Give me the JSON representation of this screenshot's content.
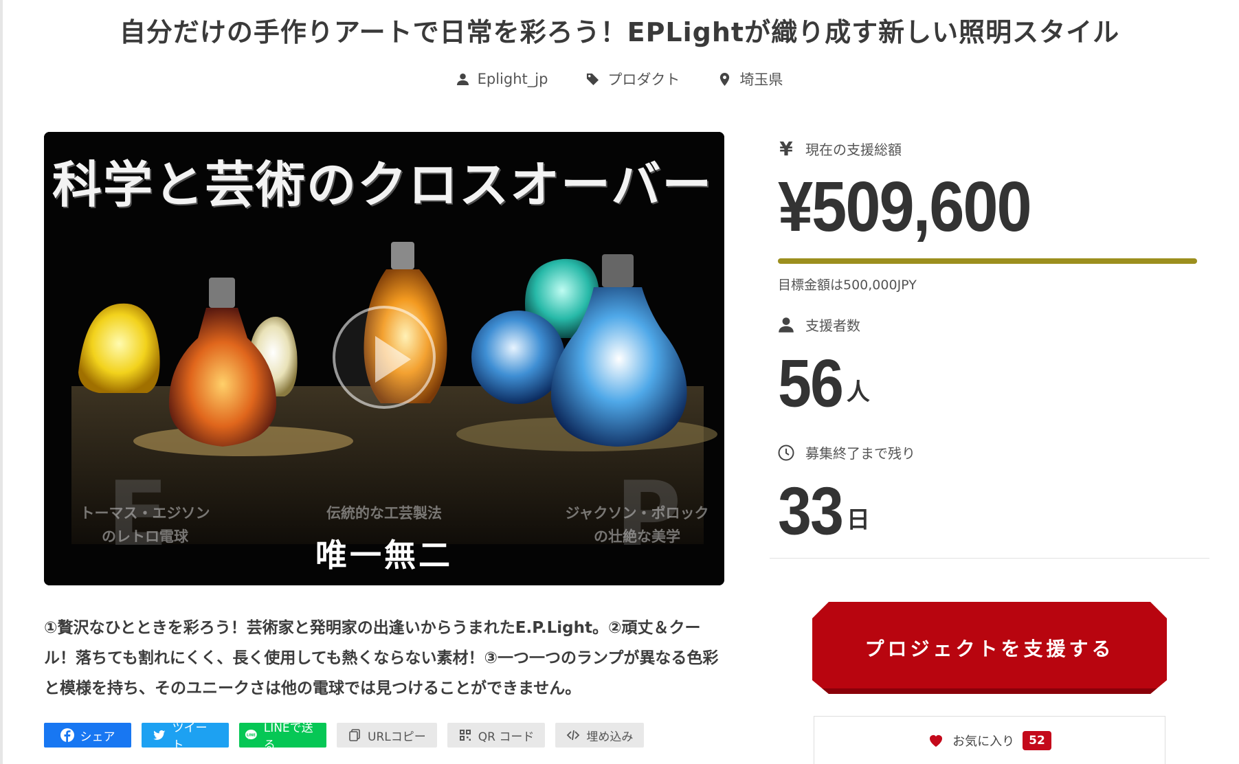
{
  "project": {
    "title": "自分だけの手作りアートで日常を彩ろう！EPLightが織り成す新しい照明スタイル",
    "author": "Eplight_jp",
    "category": "プロダクト",
    "location": "埼玉県"
  },
  "video": {
    "heading": "科学と芸術のクロスオーバー",
    "caption_left": [
      "トーマス・エジソン",
      "のレトロ電球"
    ],
    "caption_mid": "伝統的な工芸製法",
    "caption_mid_main": "唯一無二",
    "caption_right": [
      "ジャクソン・ポロック",
      "の壮絶な美学"
    ],
    "letters": [
      "E",
      "P"
    ]
  },
  "summary": "①贅沢なひとときを彩ろう！芸術家と発明家の出逢いからうまれたE.P.Light。②頑丈＆クール！落ちても割れにくく、長く使用しても熱くならない素材！③一つ一つのランプが異なる色彩と模様を持ち、そのユニークさは他の電球では見つけることができません。",
  "share": {
    "facebook": "シェア",
    "twitter": "ツイート",
    "line": "LINEで送る",
    "url_copy": "URLコピー",
    "qr": "QR コード",
    "embed": "埋め込み"
  },
  "stats": {
    "total_label": "現在の支援総額",
    "total_amount": "¥509,600",
    "progress_percent": 100,
    "goal_text": "目標金額は500,000JPY",
    "backers_label": "支援者数",
    "backers_count": "56",
    "backers_unit": "人",
    "remaining_label": "募集終了まで残り",
    "remaining_days": "33",
    "remaining_unit": "日"
  },
  "actions": {
    "support_label": "プロジェクトを支援する",
    "favorite_label": "お気に入り",
    "favorite_count": "52"
  },
  "colors": {
    "progress": "#9c8f1e",
    "support_button": "#b8050f",
    "favorite": "#c4091b"
  }
}
